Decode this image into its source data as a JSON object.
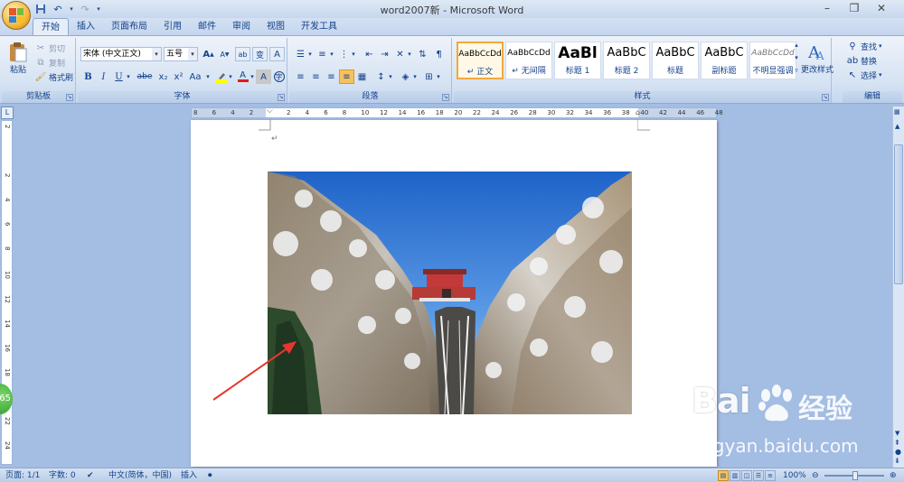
{
  "window": {
    "title": "word2007新 - Microsoft Word",
    "minimize_icon": "minimize-icon",
    "restore_icon": "restore-icon",
    "close_icon": "close-icon"
  },
  "quick_access": {
    "save_icon": "save-icon",
    "undo_icon": "undo-icon",
    "redo_icon": "redo-icon",
    "customize_icon": "dropdown-icon"
  },
  "tabs": [
    {
      "label": "开始",
      "active": true
    },
    {
      "label": "插入",
      "active": false
    },
    {
      "label": "页面布局",
      "active": false
    },
    {
      "label": "引用",
      "active": false
    },
    {
      "label": "邮件",
      "active": false
    },
    {
      "label": "审阅",
      "active": false
    },
    {
      "label": "视图",
      "active": false
    },
    {
      "label": "开发工具",
      "active": false
    }
  ],
  "ribbon": {
    "clipboard": {
      "label": "剪贴板",
      "paste": "粘贴",
      "cut": "剪切",
      "copy": "复制",
      "format_painter": "格式刷"
    },
    "font": {
      "label": "字体",
      "font_name": "宋体 (中文正文)",
      "font_size": "五号",
      "bold": "B",
      "italic": "I",
      "underline": "U",
      "strike": "abe",
      "subscript": "x₂",
      "superscript": "x²",
      "change_case": "Aa",
      "grow": "A",
      "shrink": "A",
      "clear": "A",
      "font_color": "A",
      "char_shading": "A",
      "char_border": "A"
    },
    "paragraph": {
      "label": "段落"
    },
    "styles": {
      "label": "样式",
      "items": [
        {
          "sample": "AaBbCcDd",
          "name": "↵ 正文",
          "selected": true
        },
        {
          "sample": "AaBbCcDd",
          "name": "↵ 无间隔",
          "selected": false
        },
        {
          "sample": "AaBl",
          "name": "标题 1",
          "selected": false
        },
        {
          "sample": "AaBbC",
          "name": "标题 2",
          "selected": false
        },
        {
          "sample": "AaBbC",
          "name": "标题",
          "selected": false
        },
        {
          "sample": "AaBbC",
          "name": "副标题",
          "selected": false
        },
        {
          "sample": "AaBbCcDd",
          "name": "不明显强调",
          "selected": false
        }
      ],
      "change_styles": "更改样式"
    },
    "editing": {
      "label": "编辑",
      "find": "查找",
      "replace": "替换",
      "select": "选择"
    }
  },
  "ruler": {
    "horizontal_ticks": [
      "8",
      "6",
      "4",
      "2",
      "",
      "2",
      "4",
      "6",
      "8",
      "10",
      "12",
      "14",
      "16",
      "18",
      "20",
      "22",
      "24",
      "26",
      "28",
      "30",
      "32",
      "34",
      "36",
      "38",
      "40",
      "42",
      "44",
      "46",
      "48"
    ],
    "vertical_ticks": [
      "2",
      "",
      "2",
      "4",
      "6",
      "8",
      "10",
      "12",
      "14",
      "16",
      "18",
      "20",
      "22",
      "24"
    ]
  },
  "document": {
    "paragraph_mark": "↵",
    "image_alt": "snowy mountain gorge with red temple gate"
  },
  "status": {
    "page": "页面: 1/1",
    "words": "字数: 0",
    "language": "中文(简体，中国)",
    "mode": "插入",
    "zoom": "100%"
  },
  "watermark": {
    "brand_main": "Bai",
    "brand_tail": "经验",
    "url": "jingyan.baidu.com"
  },
  "side_badge": "65",
  "colors": {
    "accent": "#15428b",
    "arrow": "#e8362f",
    "ribbon": "#d6e3f3"
  }
}
